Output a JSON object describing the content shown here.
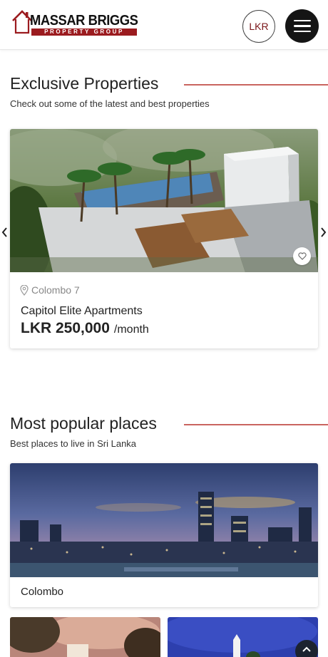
{
  "header": {
    "logo_name": "MASSAR BRIGGS",
    "logo_sub": "PROPERTY GROUP",
    "currency_label": "LKR",
    "menu_icon": "hamburger-icon"
  },
  "exclusive": {
    "title": "Exclusive Properties",
    "subtitle": "Check out some of the latest and best properties",
    "property": {
      "location": "Colombo 7",
      "name": "Capitol Elite Apartments",
      "price": "LKR 250,000",
      "price_unit": "/month"
    }
  },
  "popular": {
    "title": "Most popular places",
    "subtitle": "Best places to live in Sri Lanka",
    "places": [
      {
        "name": "Colombo"
      }
    ]
  },
  "colors": {
    "brand_red": "#9b1b1f",
    "accent_line": "#c9645f",
    "dark_button": "#151515"
  }
}
